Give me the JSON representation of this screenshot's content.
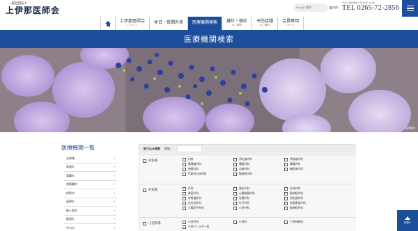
{
  "header": {
    "org_type": "一般社団法人",
    "org_name": "上伊那医師会",
    "search_placeholder": "Google 提供",
    "search_label": "検索",
    "tel_info": "代表（受付時間 平日 9:00〜17:00）",
    "tel": "TEL 0265-72-2856"
  },
  "nav": [
    {
      "label": "上伊那医師会",
      "sub": "について"
    },
    {
      "label": "休日・夜間外来",
      "sub": ""
    },
    {
      "label": "医療機関検索",
      "sub": ""
    },
    {
      "label": "健診・検診",
      "sub": "のご案内"
    },
    {
      "label": "予防接種",
      "sub": "のご案内"
    },
    {
      "label": "会員専用",
      "sub": "ページ"
    }
  ],
  "page_title": "医療機関検索",
  "hero_credit": "高遠城址",
  "sidebar": {
    "title": "医療機関一覧",
    "items": [
      "全地域",
      "高遠町",
      "箕輪町",
      "南箕輪村",
      "伊那市",
      "辰野町",
      "駒ヶ根市",
      "飯島町",
      "中川村"
    ]
  },
  "panel": {
    "filter_label": "絞り込み検索",
    "area_label": "地域：",
    "categories": [
      {
        "name": "内科系",
        "options": [
          "内科",
          "消化器内科",
          "呼吸器内科",
          "循環器内科",
          "腫瘍内科",
          "腎臓内科",
          "神経内科",
          "血液内科",
          "糖尿病内科",
          "代謝内分泌内科",
          "脳神経内科",
          ""
        ]
      },
      {
        "name": "外科系",
        "options": [
          "外科",
          "整形外科",
          "形成外科",
          "美容外科",
          "心臓血管外科",
          "脳神経外科",
          "呼吸器外科",
          "乳腺外科",
          "消化器外科",
          "内分泌外科",
          "肛門外科",
          "気管食道外科",
          "大腸肛門外科",
          "小児外科",
          "脳神経外科"
        ]
      },
      {
        "name": "小児科系",
        "options": [
          "小児外科",
          "小児科",
          "小児神経科",
          "小児アレルギー科",
          "",
          ""
        ]
      }
    ]
  },
  "to_top_label": "先頭へ"
}
